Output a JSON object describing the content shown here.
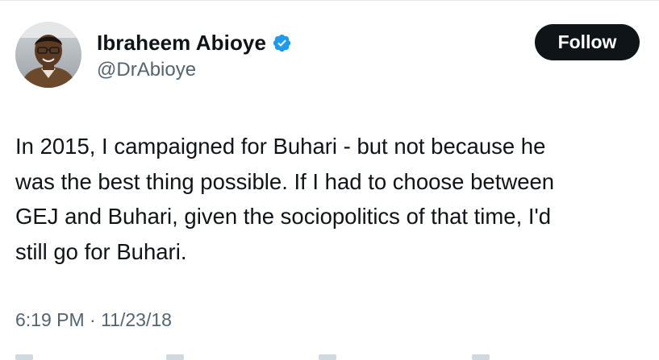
{
  "author": {
    "display_name": "Ibraheem Abioye",
    "handle": "@DrAbioye",
    "verified_icon": "verified-badge-icon",
    "avatar_icon": "profile-avatar"
  },
  "follow_button": {
    "label": "Follow"
  },
  "tweet": {
    "text": "In 2015, I campaigned for Buhari - but not because he\nwas the best thing possible. If I had to choose between\nGEJ and Buhari, given the sociopolitics of that time, I'd\nstill go for Buhari.",
    "time": "6:19 PM",
    "separator": " · ",
    "date": "11/23/18"
  },
  "colors": {
    "text": "#0f1419",
    "secondary": "#536471",
    "verified": "#1d9bf0",
    "button_bg": "#0f1419",
    "button_text": "#ffffff"
  }
}
